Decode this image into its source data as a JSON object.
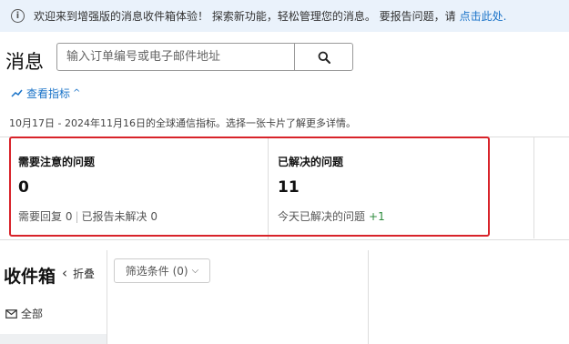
{
  "banner": {
    "icon": "info-icon",
    "text": "欢迎来到增强版的消息收件箱体验！ 探索新功能，轻松管理您的消息。 要报告问题，请",
    "link": "点击此处."
  },
  "header": {
    "title": "消息",
    "search_placeholder": "输入订单编号或电子邮件地址",
    "search_icon": "search-icon"
  },
  "metrics": {
    "toggle_label": "查看指标",
    "description": "10月17日 - 2024年11月16日的全球通信指标。选择一张卡片了解更多详情。",
    "cards": [
      {
        "title": "需要注意的问题",
        "value": "0",
        "sub_a": "需要回复 0",
        "sub_b": "已报告未解决 0"
      },
      {
        "title": "已解决的问题",
        "value": "11",
        "sub_a": "今天已解决的问题",
        "sub_delta": "+1"
      }
    ]
  },
  "inbox": {
    "title": "收件箱",
    "collapse_label": "折叠",
    "filter_label": "筛选条件 (0)",
    "all_label": "全部"
  },
  "colors": {
    "accent": "#1a73c8",
    "highlight": "#d8232a",
    "positive": "#2e8b3d",
    "banner_bg": "#eaf2fb"
  }
}
